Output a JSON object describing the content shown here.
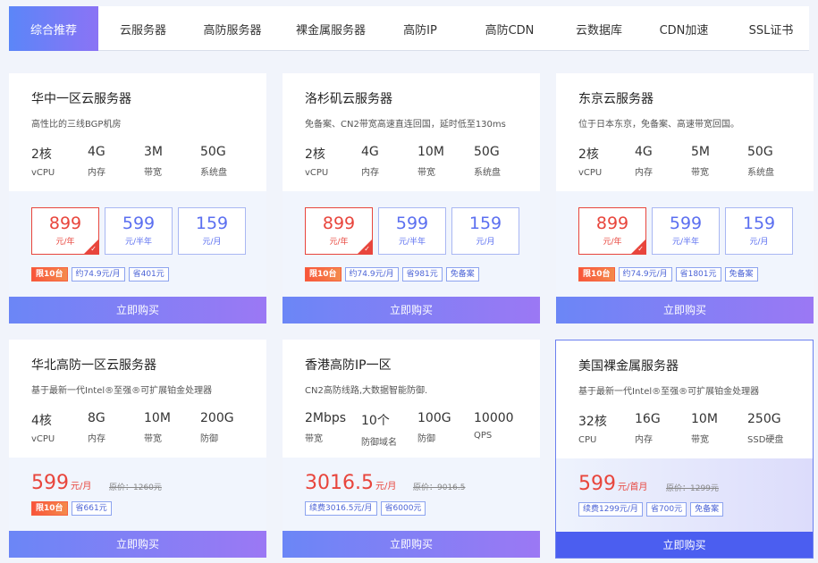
{
  "tabs": [
    "综合推荐",
    "云服务器",
    "高防服务器",
    "裸金属服务器",
    "高防IP",
    "高防CDN",
    "云数据库",
    "CDN加速",
    "SSL证书"
  ],
  "cards": [
    {
      "title": "华中一区云服务器",
      "desc": "高性比的三线BGP机房",
      "specs": [
        {
          "value": "2核",
          "label": "vCPU"
        },
        {
          "value": "4G",
          "label": "内存"
        },
        {
          "value": "3M",
          "label": "带宽"
        },
        {
          "value": "50G",
          "label": "系统盘"
        }
      ],
      "options": [
        {
          "price": "899",
          "unit": "元/年"
        },
        {
          "price": "599",
          "unit": "元/半年"
        },
        {
          "price": "159",
          "unit": "元/月"
        }
      ],
      "tags": [
        "限10台",
        "约74.9元/月",
        "省401元"
      ],
      "buy": "立即购买"
    },
    {
      "title": "洛杉矶云服务器",
      "desc": "免备案、CN2带宽高速直连回国，延时低至130ms",
      "specs": [
        {
          "value": "2核",
          "label": "vCPU"
        },
        {
          "value": "4G",
          "label": "内存"
        },
        {
          "value": "10M",
          "label": "带宽"
        },
        {
          "value": "50G",
          "label": "系统盘"
        }
      ],
      "options": [
        {
          "price": "899",
          "unit": "元/年"
        },
        {
          "price": "599",
          "unit": "元/半年"
        },
        {
          "price": "159",
          "unit": "元/月"
        }
      ],
      "tags": [
        "限10台",
        "约74.9元/月",
        "省981元",
        "免备案"
      ],
      "buy": "立即购买"
    },
    {
      "title": "东京云服务器",
      "desc": "位于日本东京，免备案、高速带宽回国。",
      "specs": [
        {
          "value": "2核",
          "label": "vCPU"
        },
        {
          "value": "4G",
          "label": "内存"
        },
        {
          "value": "5M",
          "label": "带宽"
        },
        {
          "value": "50G",
          "label": "系统盘"
        }
      ],
      "options": [
        {
          "price": "899",
          "unit": "元/年"
        },
        {
          "price": "599",
          "unit": "元/半年"
        },
        {
          "price": "159",
          "unit": "元/月"
        }
      ],
      "tags": [
        "限10台",
        "约74.9元/月",
        "省1801元",
        "免备案"
      ],
      "buy": "立即购买"
    },
    {
      "title": "华北高防一区云服务器",
      "desc": "基于最新一代Intel®至强®可扩展铂金处理器",
      "specs": [
        {
          "value": "4核",
          "label": "vCPU"
        },
        {
          "value": "8G",
          "label": "内存"
        },
        {
          "value": "10M",
          "label": "带宽"
        },
        {
          "value": "200G",
          "label": "防御"
        }
      ],
      "price": "599",
      "price_unit": "元/月",
      "orig": "原价：1260元",
      "tags": [
        "限10台",
        "省661元"
      ],
      "buy": "立即购买"
    },
    {
      "title": "香港高防IP一区",
      "desc": "CN2高防线路,大数据智能防御.",
      "specs": [
        {
          "value": "2Mbps",
          "label": "带宽"
        },
        {
          "value": "10个",
          "label": "防御域名"
        },
        {
          "value": "100G",
          "label": "防御"
        },
        {
          "value": "10000",
          "label": "QPS"
        }
      ],
      "price": "3016.5",
      "price_unit": "元/月",
      "orig": "原价：9016.5",
      "tags": [
        "续费3016.5元/月",
        "省6000元"
      ],
      "buy": "立即购买"
    },
    {
      "title": "美国裸金属服务器",
      "desc": "基于最新一代Intel®至强®可扩展铂金处理器",
      "specs": [
        {
          "value": "32核",
          "label": "CPU"
        },
        {
          "value": "16G",
          "label": "内存"
        },
        {
          "value": "10M",
          "label": "带宽"
        },
        {
          "value": "250G",
          "label": "SSD硬盘"
        }
      ],
      "price": "599",
      "price_unit": "元/首月",
      "orig": "原价：1299元",
      "tags": [
        "续费1299元/月",
        "省700元",
        "免备案"
      ],
      "buy": "立即购买"
    }
  ]
}
